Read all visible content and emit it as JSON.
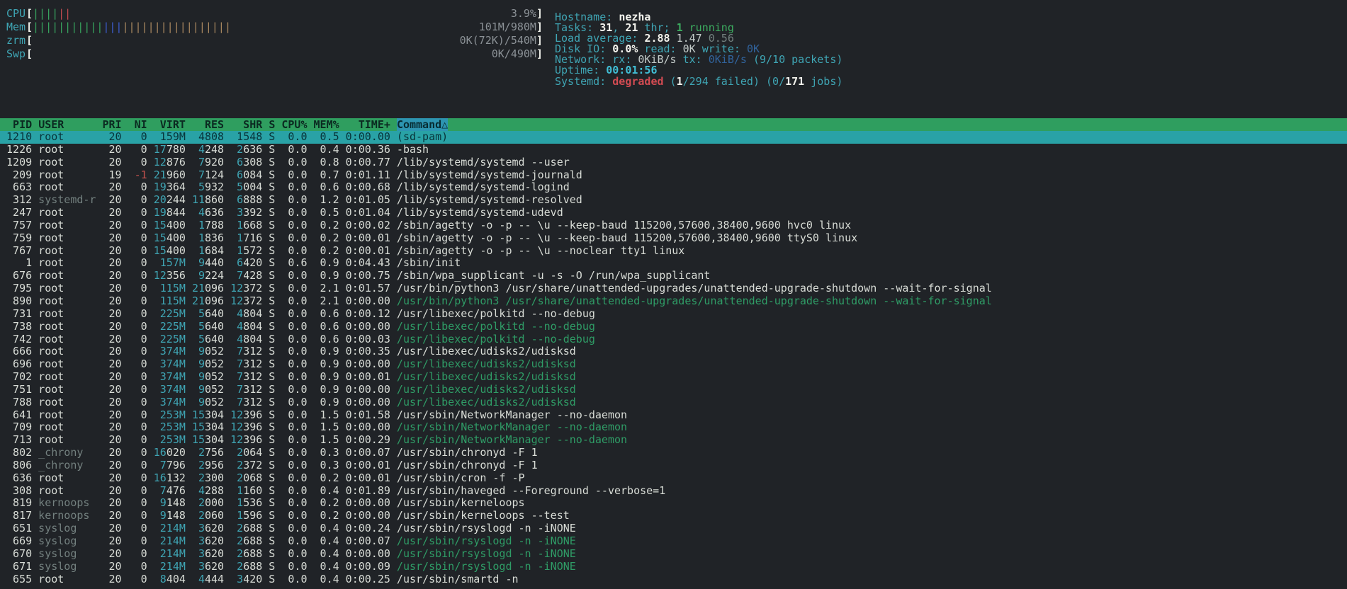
{
  "app": "htop",
  "colors": {
    "background": "#202327",
    "default_text": "#d8dcd6",
    "cyan_label": "#3fa5b4",
    "bold_white": "#f2f2ec",
    "thread_green": "#2f9c66",
    "running_green": "#3cab5f",
    "error_red": "#d24b52",
    "nice_red": "#c0504d",
    "dim_gray": "#73807f",
    "io_blue": "#31639c",
    "uptime_cyan": "#41bdd4",
    "header_bg": "#2f9e5f",
    "sort_column_bg": "#2d95b1",
    "selected_row_bg": "#29a2a6",
    "bar_green": "#37a35e",
    "bar_red": "#bf4a4f",
    "bar_blue": "#3d5ed0",
    "bar_cache_tan": "#a8875f"
  },
  "meters": [
    {
      "name": "cpu",
      "label": "CPU",
      "value": "3.9%",
      "segments": [
        {
          "color": "green",
          "count": 4
        },
        {
          "color": "red",
          "count": 2
        }
      ]
    },
    {
      "name": "mem",
      "label": "Mem",
      "value": "101M/980M",
      "segments": [
        {
          "color": "green",
          "count": 11
        },
        {
          "color": "blue",
          "count": 3
        },
        {
          "color": "tan",
          "count": 17
        }
      ]
    },
    {
      "name": "zrm",
      "label": "zrm",
      "value": "0K(72K)/540M",
      "segments": []
    },
    {
      "name": "swp",
      "label": "Swp",
      "value": "0K/490M",
      "segments": []
    }
  ],
  "info": [
    {
      "name": "hostname",
      "segments": [
        [
          "label",
          "Hostname: "
        ],
        [
          "bold",
          "nezha"
        ]
      ]
    },
    {
      "name": "tasks",
      "segments": [
        [
          "label",
          "Tasks: "
        ],
        [
          "bold",
          "31"
        ],
        [
          "label",
          ", "
        ],
        [
          "bold",
          "21"
        ],
        [
          "label",
          " thr; "
        ],
        [
          "green_bold",
          "1"
        ],
        [
          "green",
          " running"
        ]
      ]
    },
    {
      "name": "load",
      "segments": [
        [
          "label",
          "Load average: "
        ],
        [
          "bold",
          "2.88 "
        ],
        [
          "light",
          "1.47 "
        ],
        [
          "dim",
          "0.56"
        ]
      ]
    },
    {
      "name": "diskio",
      "segments": [
        [
          "label",
          "Disk IO: "
        ],
        [
          "bold",
          "0.0%"
        ],
        [
          "label",
          " read: "
        ],
        [
          "light",
          "0K"
        ],
        [
          "label",
          " write: "
        ],
        [
          "blue",
          "0K"
        ]
      ]
    },
    {
      "name": "network",
      "segments": [
        [
          "label",
          "Network: rx: "
        ],
        [
          "light",
          "0KiB/s"
        ],
        [
          "label",
          " tx: "
        ],
        [
          "blue",
          "0KiB/s"
        ],
        [
          "label",
          " (9/10 packets)"
        ]
      ]
    },
    {
      "name": "uptime",
      "segments": [
        [
          "label",
          "Uptime: "
        ],
        [
          "cyan_bold",
          "00:01:56"
        ]
      ]
    },
    {
      "name": "systemd",
      "segments": [
        [
          "label",
          "Systemd: "
        ],
        [
          "red_bold",
          "degraded"
        ],
        [
          "label",
          " ("
        ],
        [
          "bold",
          "1"
        ],
        [
          "label",
          "/294 failed) (0/"
        ],
        [
          "bold",
          "171"
        ],
        [
          "label",
          " jobs)"
        ]
      ]
    }
  ],
  "table": {
    "columns": [
      "PID",
      "USER",
      "PRI",
      "NI",
      "VIRT",
      "RES",
      "SHR",
      "S",
      "CPU%",
      "MEM%",
      "TIME+",
      "Command"
    ],
    "sort_column": "Command",
    "sort_indicator": "△",
    "dim_users": [
      "systemd-r",
      "_chrony",
      "kernoops",
      "syslog"
    ],
    "rows": [
      {
        "pid": "1210",
        "user": "root",
        "pri": "20",
        "ni": "0",
        "virt": "159M",
        "res": "4808",
        "shr": "1548",
        "s": "S",
        "cpu": "0.0",
        "mem": "0.5",
        "time": "0:00.00",
        "cmd": "(sd-pam)",
        "selected": true
      },
      {
        "pid": "1226",
        "user": "root",
        "pri": "20",
        "ni": "0",
        "virt": "17780",
        "res": "4248",
        "shr": "2636",
        "s": "S",
        "cpu": "0.0",
        "mem": "0.4",
        "time": "0:00.36",
        "cmd": "-bash"
      },
      {
        "pid": "1209",
        "user": "root",
        "pri": "20",
        "ni": "0",
        "virt": "12876",
        "res": "7920",
        "shr": "6308",
        "s": "S",
        "cpu": "0.0",
        "mem": "0.8",
        "time": "0:00.77",
        "cmd": "/lib/systemd/systemd --user"
      },
      {
        "pid": "209",
        "user": "root",
        "pri": "19",
        "ni": "-1",
        "virt": "21960",
        "res": "7124",
        "shr": "6084",
        "s": "S",
        "cpu": "0.0",
        "mem": "0.7",
        "time": "0:01.11",
        "cmd": "/lib/systemd/systemd-journald"
      },
      {
        "pid": "663",
        "user": "root",
        "pri": "20",
        "ni": "0",
        "virt": "19364",
        "res": "5932",
        "shr": "5004",
        "s": "S",
        "cpu": "0.0",
        "mem": "0.6",
        "time": "0:00.68",
        "cmd": "/lib/systemd/systemd-logind"
      },
      {
        "pid": "312",
        "user": "systemd-r",
        "pri": "20",
        "ni": "0",
        "virt": "20244",
        "res": "11860",
        "shr": "6888",
        "s": "S",
        "cpu": "0.0",
        "mem": "1.2",
        "time": "0:01.05",
        "cmd": "/lib/systemd/systemd-resolved"
      },
      {
        "pid": "247",
        "user": "root",
        "pri": "20",
        "ni": "0",
        "virt": "19844",
        "res": "4636",
        "shr": "3392",
        "s": "S",
        "cpu": "0.0",
        "mem": "0.5",
        "time": "0:01.04",
        "cmd": "/lib/systemd/systemd-udevd"
      },
      {
        "pid": "757",
        "user": "root",
        "pri": "20",
        "ni": "0",
        "virt": "15400",
        "res": "1788",
        "shr": "1668",
        "s": "S",
        "cpu": "0.0",
        "mem": "0.2",
        "time": "0:00.02",
        "cmd": "/sbin/agetty -o -p -- \\u --keep-baud 115200,57600,38400,9600 hvc0 linux"
      },
      {
        "pid": "759",
        "user": "root",
        "pri": "20",
        "ni": "0",
        "virt": "15400",
        "res": "1836",
        "shr": "1716",
        "s": "S",
        "cpu": "0.0",
        "mem": "0.2",
        "time": "0:00.01",
        "cmd": "/sbin/agetty -o -p -- \\u --keep-baud 115200,57600,38400,9600 ttyS0 linux"
      },
      {
        "pid": "767",
        "user": "root",
        "pri": "20",
        "ni": "0",
        "virt": "15400",
        "res": "1684",
        "shr": "1572",
        "s": "S",
        "cpu": "0.0",
        "mem": "0.2",
        "time": "0:00.01",
        "cmd": "/sbin/agetty -o -p -- \\u --noclear tty1 linux"
      },
      {
        "pid": "1",
        "user": "root",
        "pri": "20",
        "ni": "0",
        "virt": "157M",
        "res": "9440",
        "shr": "6420",
        "s": "S",
        "cpu": "0.6",
        "mem": "0.9",
        "time": "0:04.43",
        "cmd": "/sbin/init"
      },
      {
        "pid": "676",
        "user": "root",
        "pri": "20",
        "ni": "0",
        "virt": "12356",
        "res": "9224",
        "shr": "7428",
        "s": "S",
        "cpu": "0.0",
        "mem": "0.9",
        "time": "0:00.75",
        "cmd": "/sbin/wpa_supplicant -u -s -O /run/wpa_supplicant"
      },
      {
        "pid": "795",
        "user": "root",
        "pri": "20",
        "ni": "0",
        "virt": "115M",
        "res": "21096",
        "shr": "12372",
        "s": "S",
        "cpu": "0.0",
        "mem": "2.1",
        "time": "0:01.57",
        "cmd": "/usr/bin/python3 /usr/share/unattended-upgrades/unattended-upgrade-shutdown --wait-for-signal"
      },
      {
        "pid": "890",
        "user": "root",
        "pri": "20",
        "ni": "0",
        "virt": "115M",
        "res": "21096",
        "shr": "12372",
        "s": "S",
        "cpu": "0.0",
        "mem": "2.1",
        "time": "0:00.00",
        "cmd": "/usr/bin/python3 /usr/share/unattended-upgrades/unattended-upgrade-shutdown --wait-for-signal",
        "thread": true
      },
      {
        "pid": "731",
        "user": "root",
        "pri": "20",
        "ni": "0",
        "virt": "225M",
        "res": "5640",
        "shr": "4804",
        "s": "S",
        "cpu": "0.0",
        "mem": "0.6",
        "time": "0:00.12",
        "cmd": "/usr/libexec/polkitd --no-debug"
      },
      {
        "pid": "738",
        "user": "root",
        "pri": "20",
        "ni": "0",
        "virt": "225M",
        "res": "5640",
        "shr": "4804",
        "s": "S",
        "cpu": "0.0",
        "mem": "0.6",
        "time": "0:00.00",
        "cmd": "/usr/libexec/polkitd --no-debug",
        "thread": true
      },
      {
        "pid": "742",
        "user": "root",
        "pri": "20",
        "ni": "0",
        "virt": "225M",
        "res": "5640",
        "shr": "4804",
        "s": "S",
        "cpu": "0.0",
        "mem": "0.6",
        "time": "0:00.03",
        "cmd": "/usr/libexec/polkitd --no-debug",
        "thread": true
      },
      {
        "pid": "666",
        "user": "root",
        "pri": "20",
        "ni": "0",
        "virt": "374M",
        "res": "9052",
        "shr": "7312",
        "s": "S",
        "cpu": "0.0",
        "mem": "0.9",
        "time": "0:00.35",
        "cmd": "/usr/libexec/udisks2/udisksd"
      },
      {
        "pid": "696",
        "user": "root",
        "pri": "20",
        "ni": "0",
        "virt": "374M",
        "res": "9052",
        "shr": "7312",
        "s": "S",
        "cpu": "0.0",
        "mem": "0.9",
        "time": "0:00.00",
        "cmd": "/usr/libexec/udisks2/udisksd",
        "thread": true
      },
      {
        "pid": "702",
        "user": "root",
        "pri": "20",
        "ni": "0",
        "virt": "374M",
        "res": "9052",
        "shr": "7312",
        "s": "S",
        "cpu": "0.0",
        "mem": "0.9",
        "time": "0:00.01",
        "cmd": "/usr/libexec/udisks2/udisksd",
        "thread": true
      },
      {
        "pid": "751",
        "user": "root",
        "pri": "20",
        "ni": "0",
        "virt": "374M",
        "res": "9052",
        "shr": "7312",
        "s": "S",
        "cpu": "0.0",
        "mem": "0.9",
        "time": "0:00.00",
        "cmd": "/usr/libexec/udisks2/udisksd",
        "thread": true
      },
      {
        "pid": "788",
        "user": "root",
        "pri": "20",
        "ni": "0",
        "virt": "374M",
        "res": "9052",
        "shr": "7312",
        "s": "S",
        "cpu": "0.0",
        "mem": "0.9",
        "time": "0:00.00",
        "cmd": "/usr/libexec/udisks2/udisksd",
        "thread": true
      },
      {
        "pid": "641",
        "user": "root",
        "pri": "20",
        "ni": "0",
        "virt": "253M",
        "res": "15304",
        "shr": "12396",
        "s": "S",
        "cpu": "0.0",
        "mem": "1.5",
        "time": "0:01.58",
        "cmd": "/usr/sbin/NetworkManager --no-daemon"
      },
      {
        "pid": "709",
        "user": "root",
        "pri": "20",
        "ni": "0",
        "virt": "253M",
        "res": "15304",
        "shr": "12396",
        "s": "S",
        "cpu": "0.0",
        "mem": "1.5",
        "time": "0:00.00",
        "cmd": "/usr/sbin/NetworkManager --no-daemon",
        "thread": true
      },
      {
        "pid": "713",
        "user": "root",
        "pri": "20",
        "ni": "0",
        "virt": "253M",
        "res": "15304",
        "shr": "12396",
        "s": "S",
        "cpu": "0.0",
        "mem": "1.5",
        "time": "0:00.29",
        "cmd": "/usr/sbin/NetworkManager --no-daemon",
        "thread": true
      },
      {
        "pid": "802",
        "user": "_chrony",
        "pri": "20",
        "ni": "0",
        "virt": "16020",
        "res": "2756",
        "shr": "2064",
        "s": "S",
        "cpu": "0.0",
        "mem": "0.3",
        "time": "0:00.07",
        "cmd": "/usr/sbin/chronyd -F 1"
      },
      {
        "pid": "806",
        "user": "_chrony",
        "pri": "20",
        "ni": "0",
        "virt": "7796",
        "res": "2956",
        "shr": "2372",
        "s": "S",
        "cpu": "0.0",
        "mem": "0.3",
        "time": "0:00.01",
        "cmd": "/usr/sbin/chronyd -F 1"
      },
      {
        "pid": "636",
        "user": "root",
        "pri": "20",
        "ni": "0",
        "virt": "16132",
        "res": "2300",
        "shr": "2068",
        "s": "S",
        "cpu": "0.0",
        "mem": "0.2",
        "time": "0:00.01",
        "cmd": "/usr/sbin/cron -f -P"
      },
      {
        "pid": "308",
        "user": "root",
        "pri": "20",
        "ni": "0",
        "virt": "7476",
        "res": "4288",
        "shr": "1160",
        "s": "S",
        "cpu": "0.0",
        "mem": "0.4",
        "time": "0:01.89",
        "cmd": "/usr/sbin/haveged --Foreground --verbose=1"
      },
      {
        "pid": "819",
        "user": "kernoops",
        "pri": "20",
        "ni": "0",
        "virt": "9148",
        "res": "2000",
        "shr": "1536",
        "s": "S",
        "cpu": "0.0",
        "mem": "0.2",
        "time": "0:00.00",
        "cmd": "/usr/sbin/kerneloops"
      },
      {
        "pid": "817",
        "user": "kernoops",
        "pri": "20",
        "ni": "0",
        "virt": "9148",
        "res": "2060",
        "shr": "1596",
        "s": "S",
        "cpu": "0.0",
        "mem": "0.2",
        "time": "0:00.00",
        "cmd": "/usr/sbin/kerneloops --test"
      },
      {
        "pid": "651",
        "user": "syslog",
        "pri": "20",
        "ni": "0",
        "virt": "214M",
        "res": "3620",
        "shr": "2688",
        "s": "S",
        "cpu": "0.0",
        "mem": "0.4",
        "time": "0:00.24",
        "cmd": "/usr/sbin/rsyslogd -n -iNONE"
      },
      {
        "pid": "669",
        "user": "syslog",
        "pri": "20",
        "ni": "0",
        "virt": "214M",
        "res": "3620",
        "shr": "2688",
        "s": "S",
        "cpu": "0.0",
        "mem": "0.4",
        "time": "0:00.07",
        "cmd": "/usr/sbin/rsyslogd -n -iNONE",
        "thread": true
      },
      {
        "pid": "670",
        "user": "syslog",
        "pri": "20",
        "ni": "0",
        "virt": "214M",
        "res": "3620",
        "shr": "2688",
        "s": "S",
        "cpu": "0.0",
        "mem": "0.4",
        "time": "0:00.00",
        "cmd": "/usr/sbin/rsyslogd -n -iNONE",
        "thread": true
      },
      {
        "pid": "671",
        "user": "syslog",
        "pri": "20",
        "ni": "0",
        "virt": "214M",
        "res": "3620",
        "shr": "2688",
        "s": "S",
        "cpu": "0.0",
        "mem": "0.4",
        "time": "0:00.09",
        "cmd": "/usr/sbin/rsyslogd -n -iNONE",
        "thread": true
      },
      {
        "pid": "655",
        "user": "root",
        "pri": "20",
        "ni": "0",
        "virt": "8404",
        "res": "4444",
        "shr": "3420",
        "s": "S",
        "cpu": "0.0",
        "mem": "0.4",
        "time": "0:00.25",
        "cmd": "/usr/sbin/smartd -n"
      }
    ]
  }
}
